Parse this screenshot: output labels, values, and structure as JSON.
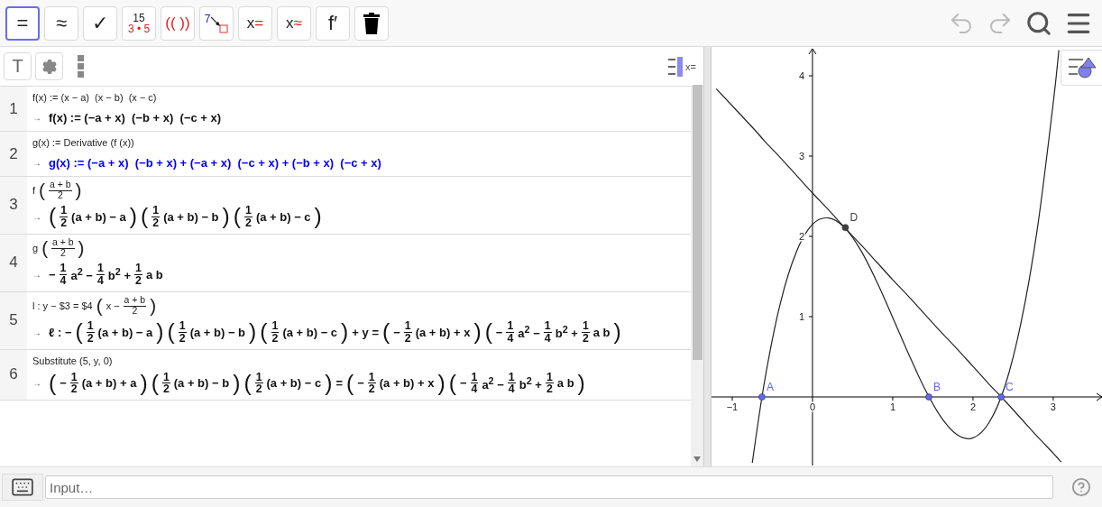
{
  "toolbar": {
    "tools": [
      {
        "kind": "symbol",
        "label": "=",
        "selected": true
      },
      {
        "kind": "symbol",
        "label": "≈",
        "selected": false
      },
      {
        "kind": "symbol",
        "label": "✓",
        "selected": false
      },
      {
        "kind": "factor",
        "label": "15",
        "sub": "3 • 5",
        "selected": false
      },
      {
        "kind": "expand",
        "label": "(( ))",
        "selected": false
      },
      {
        "kind": "substitute",
        "label": "7",
        "selected": false
      },
      {
        "kind": "solve",
        "label": "x",
        "sign": "=",
        "selected": false
      },
      {
        "kind": "solve",
        "label": "x",
        "sign": "≈",
        "selected": false
      },
      {
        "kind": "symbol",
        "label": "f′",
        "selected": false
      },
      {
        "kind": "delete",
        "selected": false
      }
    ]
  },
  "cas_toolbar": {
    "text_button": "T",
    "view_toggle": "x="
  },
  "cas": {
    "rows": [
      {
        "number": "1",
        "input": [
          "f(x) := (x − a)  (x − b)  (x − c)"
        ],
        "marker": "→",
        "highlighted": false,
        "output": [
          "f(x) := (−a + x)  (−b + x)  (−c + x)"
        ]
      },
      {
        "number": "2",
        "input": [
          "g(x) := Derivative (f (x))"
        ],
        "marker": "→",
        "highlighted": true,
        "output": [
          "g(x) := (−a + x)  (−b + x) + (−a + x)  (−c + x) + (−b + x)  (−c + x)"
        ]
      },
      {
        "number": "3",
        "input": [
          "f",
          {
            "paren": "("
          },
          {
            "num": "a + b",
            "den": "2"
          },
          {
            "paren": ")"
          }
        ],
        "marker": "→",
        "highlighted": false,
        "output": [
          {
            "paren": "("
          },
          {
            "num": "1",
            "den": "2"
          },
          "(a + b) − a",
          {
            "paren": ")"
          },
          {
            "paren": "("
          },
          {
            "num": "1",
            "den": "2"
          },
          "(a + b) − b",
          {
            "paren": ")"
          },
          {
            "paren": "("
          },
          {
            "num": "1",
            "den": "2"
          },
          "(a + b) − c",
          {
            "paren": ")"
          }
        ]
      },
      {
        "number": "4",
        "input": [
          "g",
          {
            "paren": "("
          },
          {
            "num": "a + b",
            "den": "2"
          },
          {
            "paren": ")"
          }
        ],
        "marker": "→",
        "highlighted": false,
        "output": [
          "−",
          {
            "num": "1",
            "den": "4"
          },
          {
            "rich": "a$^{2}$ −"
          },
          {
            "num": "1",
            "den": "4"
          },
          {
            "rich": "b$^{2}$ +"
          },
          {
            "num": "1",
            "den": "2"
          },
          "a b"
        ]
      },
      {
        "number": "5",
        "input": [
          "l : y − $3 = $4",
          {
            "paren": "("
          },
          "x −",
          {
            "num": "a + b",
            "den": "2"
          },
          {
            "paren": ")"
          }
        ],
        "marker": "→",
        "highlighted": false,
        "output": [
          "ℓ : −",
          {
            "paren": "("
          },
          {
            "num": "1",
            "den": "2"
          },
          "(a + b) − a",
          {
            "paren": ")"
          },
          {
            "paren": "("
          },
          {
            "num": "1",
            "den": "2"
          },
          "(a + b) − b",
          {
            "paren": ")"
          },
          {
            "paren": "("
          },
          {
            "num": "1",
            "den": "2"
          },
          "(a + b) − c",
          {
            "paren": ")"
          },
          "+ y =",
          {
            "paren": "("
          },
          "−",
          {
            "num": "1",
            "den": "2"
          },
          "(a + b) + x",
          {
            "paren": ")"
          },
          {
            "paren": "("
          },
          "−",
          {
            "num": "1",
            "den": "4"
          },
          {
            "rich": "a$^{2}$ −"
          },
          {
            "num": "1",
            "den": "4"
          },
          {
            "rich": "b$^{2}$ +"
          },
          {
            "num": "1",
            "den": "2"
          },
          "a b",
          {
            "paren": ")"
          }
        ]
      },
      {
        "number": "6",
        "input": [
          "Substitute (5, y, 0)"
        ],
        "marker": "→",
        "highlighted": false,
        "output": [
          {
            "paren": "("
          },
          "−",
          {
            "num": "1",
            "den": "2"
          },
          "(a + b) + a",
          {
            "paren": ")"
          },
          {
            "paren": "("
          },
          {
            "num": "1",
            "den": "2"
          },
          "(a + b) − b",
          {
            "paren": ")"
          },
          {
            "paren": "("
          },
          {
            "num": "1",
            "den": "2"
          },
          "(a + b) − c",
          {
            "paren": ")"
          },
          "=",
          {
            "paren": "("
          },
          "−",
          {
            "num": "1",
            "den": "2"
          },
          "(a + b) + x",
          {
            "paren": ")"
          },
          {
            "paren": "("
          },
          "−",
          {
            "num": "1",
            "den": "4"
          },
          {
            "rich": "a$^{2}$ −"
          },
          {
            "num": "1",
            "den": "4"
          },
          {
            "rich": "b$^{2}$ +"
          },
          {
            "num": "1",
            "den": "2"
          },
          "a b",
          {
            "paren": ")"
          }
        ]
      }
    ]
  },
  "graphics": {
    "chart_data": {
      "type": "line",
      "x": [
        -1.2,
        -0.75,
        -0.6,
        -0.4,
        -0.2,
        0,
        0.2,
        0.4,
        0.6,
        0.8,
        1.0,
        1.2,
        1.4,
        1.6,
        1.8,
        2.0,
        2.2,
        2.4,
        2.6,
        2.8,
        3.0,
        3.07,
        3.1
      ],
      "series": [
        {
          "color": "#222222",
          "values": [
            null,
            -0.82,
            0.18,
            1.17,
            1.81,
            2.15,
            2.23,
            2.11,
            1.83,
            1.44,
            0.99,
            0.53,
            0.1,
            -0.25,
            -0.47,
            -0.51,
            -0.32,
            0.14,
            0.93,
            2.08,
            3.66,
            4.32,
            null
          ]
        },
        {
          "color": "#222222",
          "values": [
            3.84,
            3.36,
            3.19,
            2.98,
            2.76,
            2.54,
            2.33,
            2.11,
            1.9,
            1.68,
            1.46,
            1.25,
            1.03,
            0.81,
            0.6,
            0.38,
            0.16,
            -0.05,
            -0.27,
            -0.49,
            -0.7,
            -0.78,
            -0.81
          ]
        }
      ],
      "xlim": [
        -1.258,
        3.63
      ],
      "ylim": [
        -0.854,
        4.36
      ],
      "xticks": [
        {
          "value": -1,
          "label": "−1"
        },
        0,
        1,
        2,
        3
      ],
      "yticks": [
        4,
        3,
        2,
        1
      ]
    },
    "points": [
      {
        "label": "A",
        "color": "#6464ff"
      },
      {
        "label": "B",
        "color": "#6464ff"
      },
      {
        "label": "C",
        "color": "#6464ff"
      },
      {
        "label": "D",
        "color": "#404040"
      }
    ]
  },
  "input_bar": {
    "placeholder": "Input…"
  }
}
